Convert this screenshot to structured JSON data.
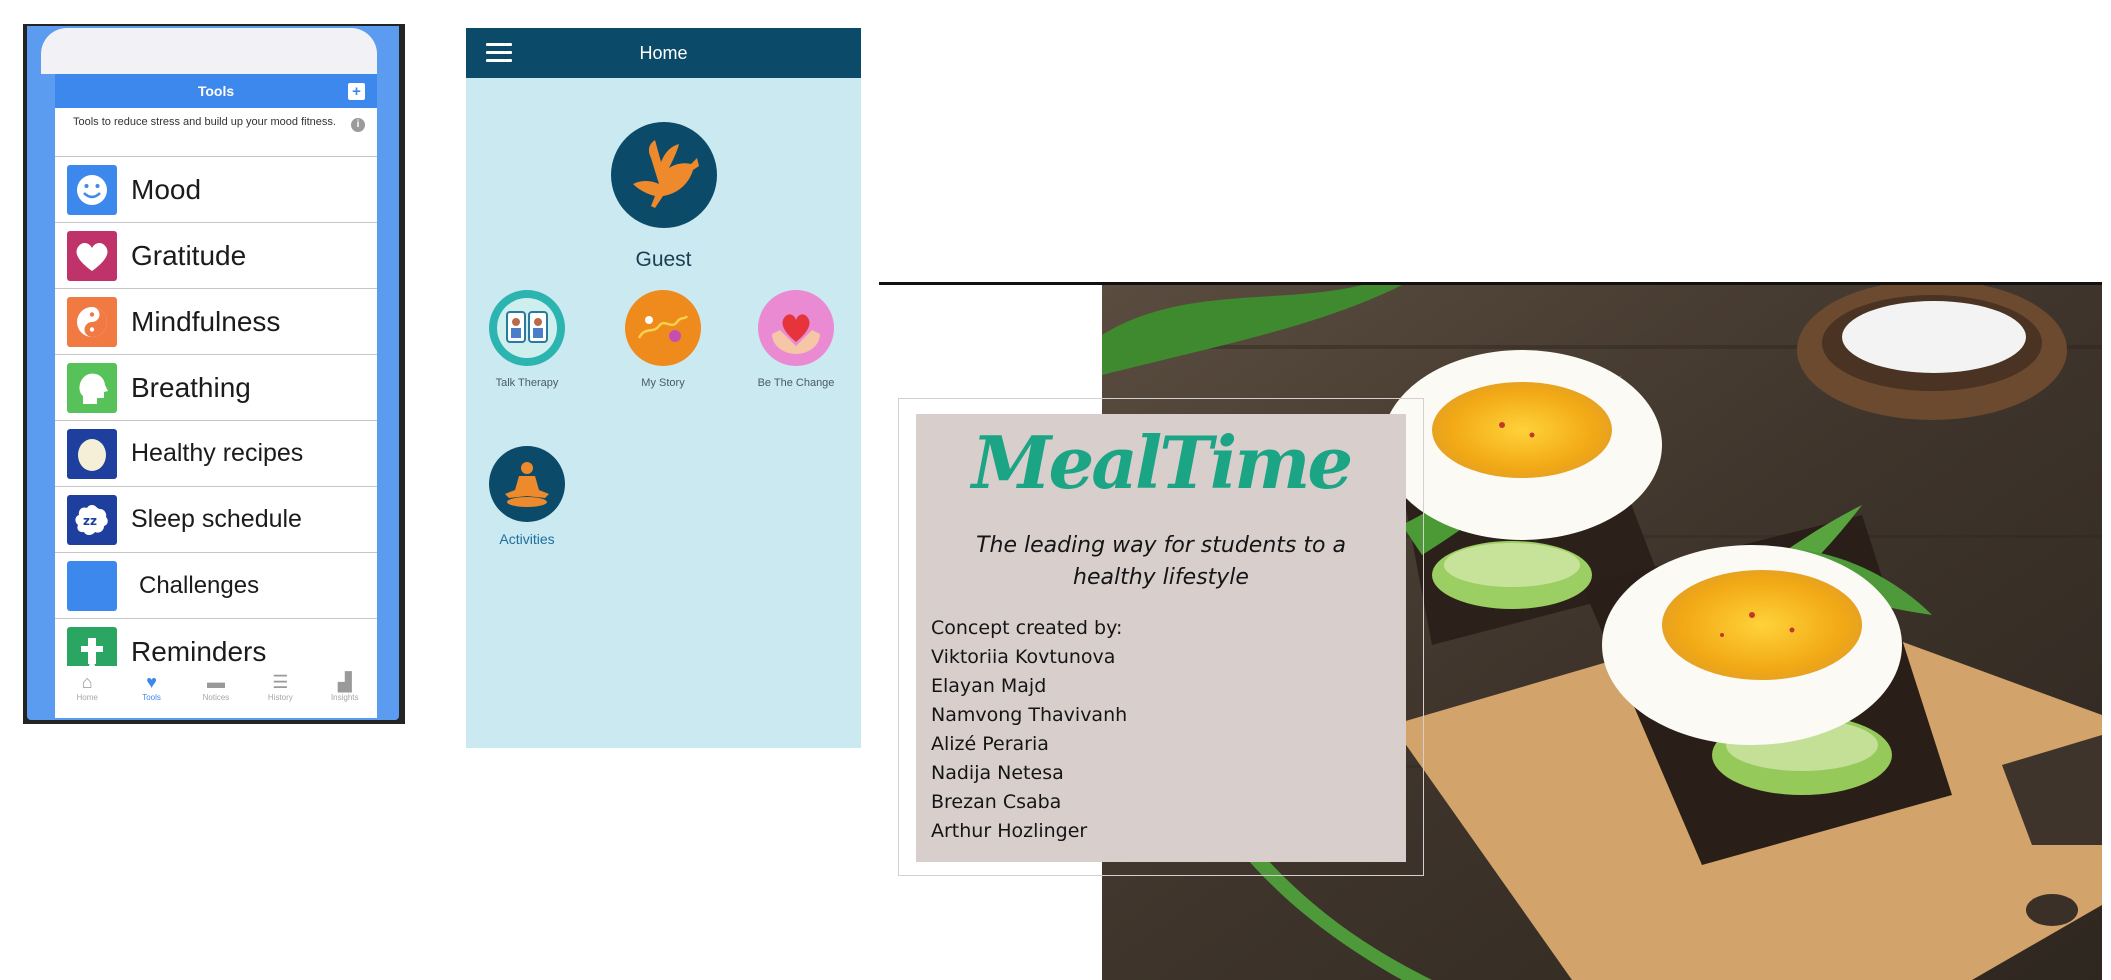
{
  "tools_app": {
    "title": "Tools",
    "plus_icon": "+",
    "description": "Tools to reduce stress and build up your mood fitness.",
    "info_icon": "i",
    "items": [
      {
        "label": "Mood",
        "icon": "smiley-face-icon",
        "color": "#3d88ec"
      },
      {
        "label": "Gratitude",
        "icon": "heart-icon",
        "color": "#c0336a"
      },
      {
        "label": "Mindfulness",
        "icon": "yin-yang-icon",
        "color": "#f07a42"
      },
      {
        "label": "Breathing",
        "icon": "head-profile-icon",
        "color": "#58c25a"
      },
      {
        "label": "Healthy recipes",
        "icon": "egg-icon",
        "color": "#1f3f9e"
      },
      {
        "label": "Sleep schedule",
        "icon": "zzz-sleep-icon",
        "color": "#1f3f9e"
      },
      {
        "label": "Challenges",
        "icon": "blank-square-icon",
        "color": "#3d88ec"
      },
      {
        "label": "Reminders",
        "icon": "reminder-bell-icon",
        "color": "#2aa562"
      }
    ],
    "tabs": [
      {
        "label": "Home",
        "icon": "home-icon"
      },
      {
        "label": "Tools",
        "icon": "heart-tab-icon"
      },
      {
        "label": "Notices",
        "icon": "speech-bubble-icon"
      },
      {
        "label": "History",
        "icon": "list-icon"
      },
      {
        "label": "Insights",
        "icon": "bar-chart-icon"
      }
    ]
  },
  "home_app": {
    "title": "Home",
    "user_name": "Guest",
    "tiles": [
      {
        "label": "Talk Therapy",
        "icon": "talk-therapy-icon"
      },
      {
        "label": "My Story",
        "icon": "my-story-icon"
      },
      {
        "label": "Be The Change",
        "icon": "be-the-change-icon"
      },
      {
        "label": "Activities",
        "icon": "meditation-icon"
      }
    ]
  },
  "slide": {
    "brand": "MealTime",
    "tagline": "The leading way for students to a healthy lifestyle",
    "credits_heading": "Concept created by:",
    "authors": [
      "Viktoriia Kovtunova",
      "Elayan Majd",
      "Namvong Thavivanh",
      "Alizé Peraria",
      "Nadija Netesa",
      "Brezan Csaba",
      "Arthur Hozlinger"
    ]
  },
  "colors": {
    "tools_blue": "#3d88ec",
    "home_navy": "#0b4a68",
    "home_bg": "#cbe9f1",
    "brand_green": "#1ca585",
    "card_bg": "#d8cfcd"
  }
}
